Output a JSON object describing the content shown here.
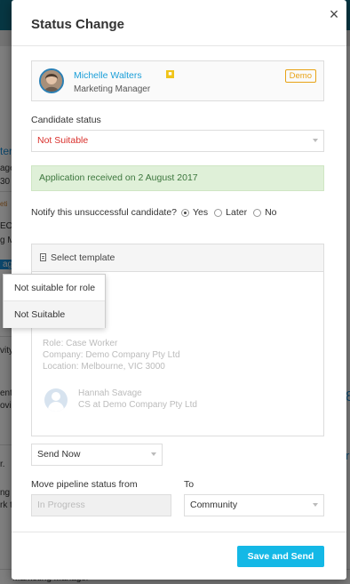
{
  "background": {
    "fragments": [
      "ter",
      "age",
      "30",
      "eti",
      "EO S",
      "g M",
      "age",
      "vity",
      "ent",
      "ovi",
      "r.",
      "ng",
      "rk t",
      "Marketing Manager",
      "8",
      "r"
    ]
  },
  "modal": {
    "title": "Status Change",
    "close_label": "×",
    "candidate": {
      "name": "Michelle Walters",
      "flag_icon": "flag-icon",
      "role": "Marketing Manager",
      "badge": "Demo"
    },
    "candidate_status": {
      "label": "Candidate status",
      "value": "Not Suitable"
    },
    "alert": "Application received on 2 August 2017",
    "notify": {
      "question": "Notify this unsuccessful candidate?",
      "options": [
        "Yes",
        "Later",
        "No"
      ],
      "selected": "Yes"
    },
    "email": {
      "template_label": "Select template",
      "template_options": [
        "Not suitable for role",
        "Not Suitable"
      ],
      "body_lines": [
        "Role: Case Worker",
        "Company: Demo Company Pty Ltd",
        "Location: Melbourne, VIC 3000"
      ],
      "signature_name": "Hannah Savage",
      "signature_title": "CS at Demo Company Pty Ltd"
    },
    "send_option": "Send Now",
    "pipeline": {
      "from_label": "Move pipeline status from",
      "from_value": "In Progress",
      "to_label": "To",
      "to_value": "Community"
    },
    "save_button": "Save and Send"
  },
  "colors": {
    "accent": "#14b8e6",
    "link": "#1a9ed8",
    "error": "#d9302c",
    "success_bg": "#dff0d8",
    "badge": "#e8a317"
  }
}
